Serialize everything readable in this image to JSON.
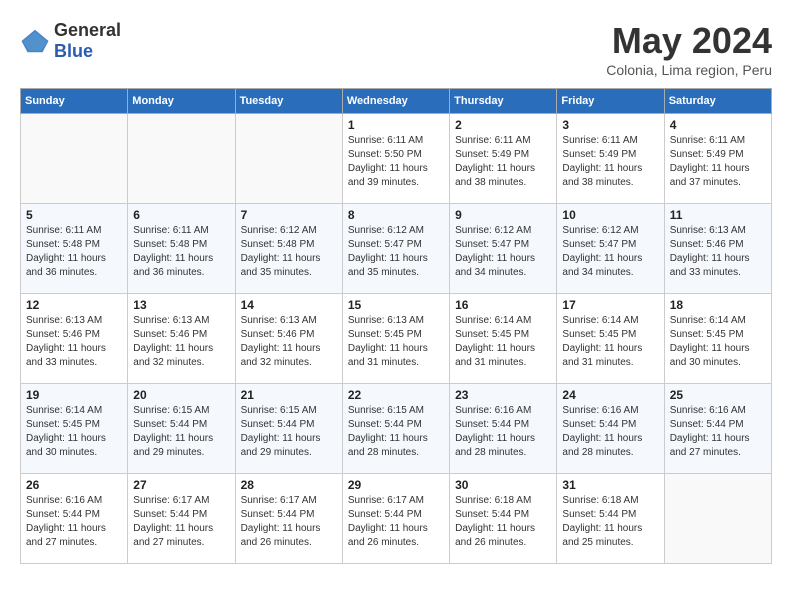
{
  "header": {
    "logo_general": "General",
    "logo_blue": "Blue",
    "month_title": "May 2024",
    "subtitle": "Colonia, Lima region, Peru"
  },
  "days_of_week": [
    "Sunday",
    "Monday",
    "Tuesday",
    "Wednesday",
    "Thursday",
    "Friday",
    "Saturday"
  ],
  "weeks": [
    [
      {
        "day": "",
        "info": ""
      },
      {
        "day": "",
        "info": ""
      },
      {
        "day": "",
        "info": ""
      },
      {
        "day": "1",
        "info": "Sunrise: 6:11 AM\nSunset: 5:50 PM\nDaylight: 11 hours\nand 39 minutes."
      },
      {
        "day": "2",
        "info": "Sunrise: 6:11 AM\nSunset: 5:49 PM\nDaylight: 11 hours\nand 38 minutes."
      },
      {
        "day": "3",
        "info": "Sunrise: 6:11 AM\nSunset: 5:49 PM\nDaylight: 11 hours\nand 38 minutes."
      },
      {
        "day": "4",
        "info": "Sunrise: 6:11 AM\nSunset: 5:49 PM\nDaylight: 11 hours\nand 37 minutes."
      }
    ],
    [
      {
        "day": "5",
        "info": "Sunrise: 6:11 AM\nSunset: 5:48 PM\nDaylight: 11 hours\nand 36 minutes."
      },
      {
        "day": "6",
        "info": "Sunrise: 6:11 AM\nSunset: 5:48 PM\nDaylight: 11 hours\nand 36 minutes."
      },
      {
        "day": "7",
        "info": "Sunrise: 6:12 AM\nSunset: 5:48 PM\nDaylight: 11 hours\nand 35 minutes."
      },
      {
        "day": "8",
        "info": "Sunrise: 6:12 AM\nSunset: 5:47 PM\nDaylight: 11 hours\nand 35 minutes."
      },
      {
        "day": "9",
        "info": "Sunrise: 6:12 AM\nSunset: 5:47 PM\nDaylight: 11 hours\nand 34 minutes."
      },
      {
        "day": "10",
        "info": "Sunrise: 6:12 AM\nSunset: 5:47 PM\nDaylight: 11 hours\nand 34 minutes."
      },
      {
        "day": "11",
        "info": "Sunrise: 6:13 AM\nSunset: 5:46 PM\nDaylight: 11 hours\nand 33 minutes."
      }
    ],
    [
      {
        "day": "12",
        "info": "Sunrise: 6:13 AM\nSunset: 5:46 PM\nDaylight: 11 hours\nand 33 minutes."
      },
      {
        "day": "13",
        "info": "Sunrise: 6:13 AM\nSunset: 5:46 PM\nDaylight: 11 hours\nand 32 minutes."
      },
      {
        "day": "14",
        "info": "Sunrise: 6:13 AM\nSunset: 5:46 PM\nDaylight: 11 hours\nand 32 minutes."
      },
      {
        "day": "15",
        "info": "Sunrise: 6:13 AM\nSunset: 5:45 PM\nDaylight: 11 hours\nand 31 minutes."
      },
      {
        "day": "16",
        "info": "Sunrise: 6:14 AM\nSunset: 5:45 PM\nDaylight: 11 hours\nand 31 minutes."
      },
      {
        "day": "17",
        "info": "Sunrise: 6:14 AM\nSunset: 5:45 PM\nDaylight: 11 hours\nand 31 minutes."
      },
      {
        "day": "18",
        "info": "Sunrise: 6:14 AM\nSunset: 5:45 PM\nDaylight: 11 hours\nand 30 minutes."
      }
    ],
    [
      {
        "day": "19",
        "info": "Sunrise: 6:14 AM\nSunset: 5:45 PM\nDaylight: 11 hours\nand 30 minutes."
      },
      {
        "day": "20",
        "info": "Sunrise: 6:15 AM\nSunset: 5:44 PM\nDaylight: 11 hours\nand 29 minutes."
      },
      {
        "day": "21",
        "info": "Sunrise: 6:15 AM\nSunset: 5:44 PM\nDaylight: 11 hours\nand 29 minutes."
      },
      {
        "day": "22",
        "info": "Sunrise: 6:15 AM\nSunset: 5:44 PM\nDaylight: 11 hours\nand 28 minutes."
      },
      {
        "day": "23",
        "info": "Sunrise: 6:16 AM\nSunset: 5:44 PM\nDaylight: 11 hours\nand 28 minutes."
      },
      {
        "day": "24",
        "info": "Sunrise: 6:16 AM\nSunset: 5:44 PM\nDaylight: 11 hours\nand 28 minutes."
      },
      {
        "day": "25",
        "info": "Sunrise: 6:16 AM\nSunset: 5:44 PM\nDaylight: 11 hours\nand 27 minutes."
      }
    ],
    [
      {
        "day": "26",
        "info": "Sunrise: 6:16 AM\nSunset: 5:44 PM\nDaylight: 11 hours\nand 27 minutes."
      },
      {
        "day": "27",
        "info": "Sunrise: 6:17 AM\nSunset: 5:44 PM\nDaylight: 11 hours\nand 27 minutes."
      },
      {
        "day": "28",
        "info": "Sunrise: 6:17 AM\nSunset: 5:44 PM\nDaylight: 11 hours\nand 26 minutes."
      },
      {
        "day": "29",
        "info": "Sunrise: 6:17 AM\nSunset: 5:44 PM\nDaylight: 11 hours\nand 26 minutes."
      },
      {
        "day": "30",
        "info": "Sunrise: 6:18 AM\nSunset: 5:44 PM\nDaylight: 11 hours\nand 26 minutes."
      },
      {
        "day": "31",
        "info": "Sunrise: 6:18 AM\nSunset: 5:44 PM\nDaylight: 11 hours\nand 25 minutes."
      },
      {
        "day": "",
        "info": ""
      }
    ]
  ]
}
